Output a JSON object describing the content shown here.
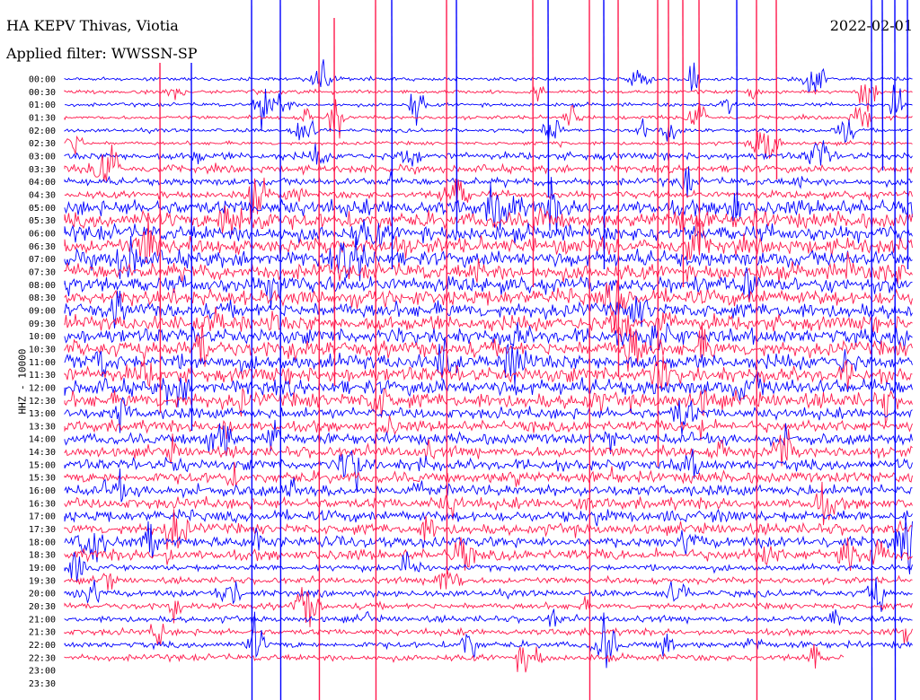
{
  "header": {
    "station": "HA KEPV Thivas, Viotia",
    "filter": "Applied filter: WWSSN-SP",
    "date": "2022-02-01",
    "scale_label": "HHZ - 10000"
  },
  "colors": {
    "trace_a": "#0000ff",
    "trace_b": "#ff1a4d"
  },
  "chart_data": {
    "type": "helicorder",
    "title": "HA KEPV Thivas, Viotia",
    "subtitle": "Applied filter: WWSSN-SP",
    "date": "2022-02-01",
    "ylabel": "HHZ - 10000",
    "row_interval_minutes": 15,
    "time_labels": [
      "00:00",
      "00:30",
      "01:00",
      "01:30",
      "02:00",
      "02:30",
      "03:00",
      "03:30",
      "04:00",
      "04:30",
      "05:00",
      "05:30",
      "06:00",
      "06:30",
      "07:00",
      "07:30",
      "08:00",
      "08:30",
      "09:00",
      "09:30",
      "10:00",
      "10:30",
      "11:00",
      "11:30",
      "12:00",
      "12:30",
      "13:00",
      "13:30",
      "14:00",
      "14:30",
      "15:00",
      "15:30",
      "16:00",
      "16:30",
      "17:00",
      "17:30",
      "18:00",
      "18:30",
      "19:00",
      "19:30",
      "20:00",
      "20:30",
      "21:00",
      "21:30",
      "22:00",
      "22:30",
      "23:00",
      "23:30"
    ],
    "trace_colors": [
      "#0000ff",
      "#ff1a4d"
    ],
    "data_ends_at_label": "22:30",
    "grid": false,
    "legend": "none"
  }
}
